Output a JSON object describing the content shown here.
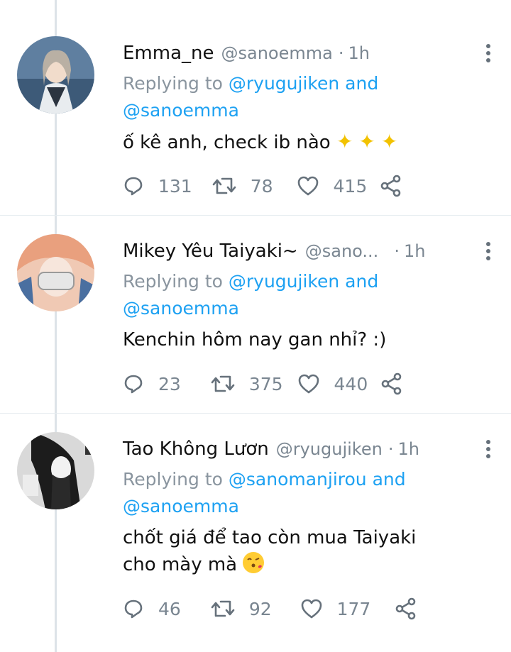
{
  "tweets": [
    {
      "name": "Emma_ne",
      "handle": "@sanoemma",
      "dot": "·",
      "time": "1h",
      "replying_prefix": "Replying to ",
      "replying_to_1": "@ryugujiken",
      "replying_and": " and",
      "replying_to_2": "@sanoemma",
      "text": "ố kê anh, check ib nào",
      "emoji": "sparkles ✨✨✨",
      "replies": "131",
      "retweets": "78",
      "likes": "415"
    },
    {
      "name": "Mikey Yêu Taiyaki~",
      "handle": "@sano...",
      "dot": "·",
      "time": "1h",
      "replying_prefix": "Replying to ",
      "replying_to_1": "@ryugujiken",
      "replying_and": " and",
      "replying_to_2": "@sanoemma",
      "text": "Kenchin hôm nay gan nhỉ? :)",
      "replies": "23",
      "retweets": "375",
      "likes": "440"
    },
    {
      "name": "Tao Không Lươn",
      "handle": "@ryugujiken",
      "dot": "·",
      "time": "1h",
      "replying_prefix": "Replying to ",
      "replying_to_1": "@sanomanjirou",
      "replying_and": " and",
      "replying_to_2": "@sanoemma",
      "text_line1": "chốt giá để tao còn mua Taiyaki",
      "text_line2": "cho mày mà",
      "emoji": "face-blowing-a-kiss",
      "replies": "46",
      "retweets": "92",
      "likes": "177"
    }
  ],
  "colors": {
    "link": "#1da1f2",
    "muted": "#7a8691",
    "thread_line": "#dde3e8",
    "icon": "#66717b"
  }
}
